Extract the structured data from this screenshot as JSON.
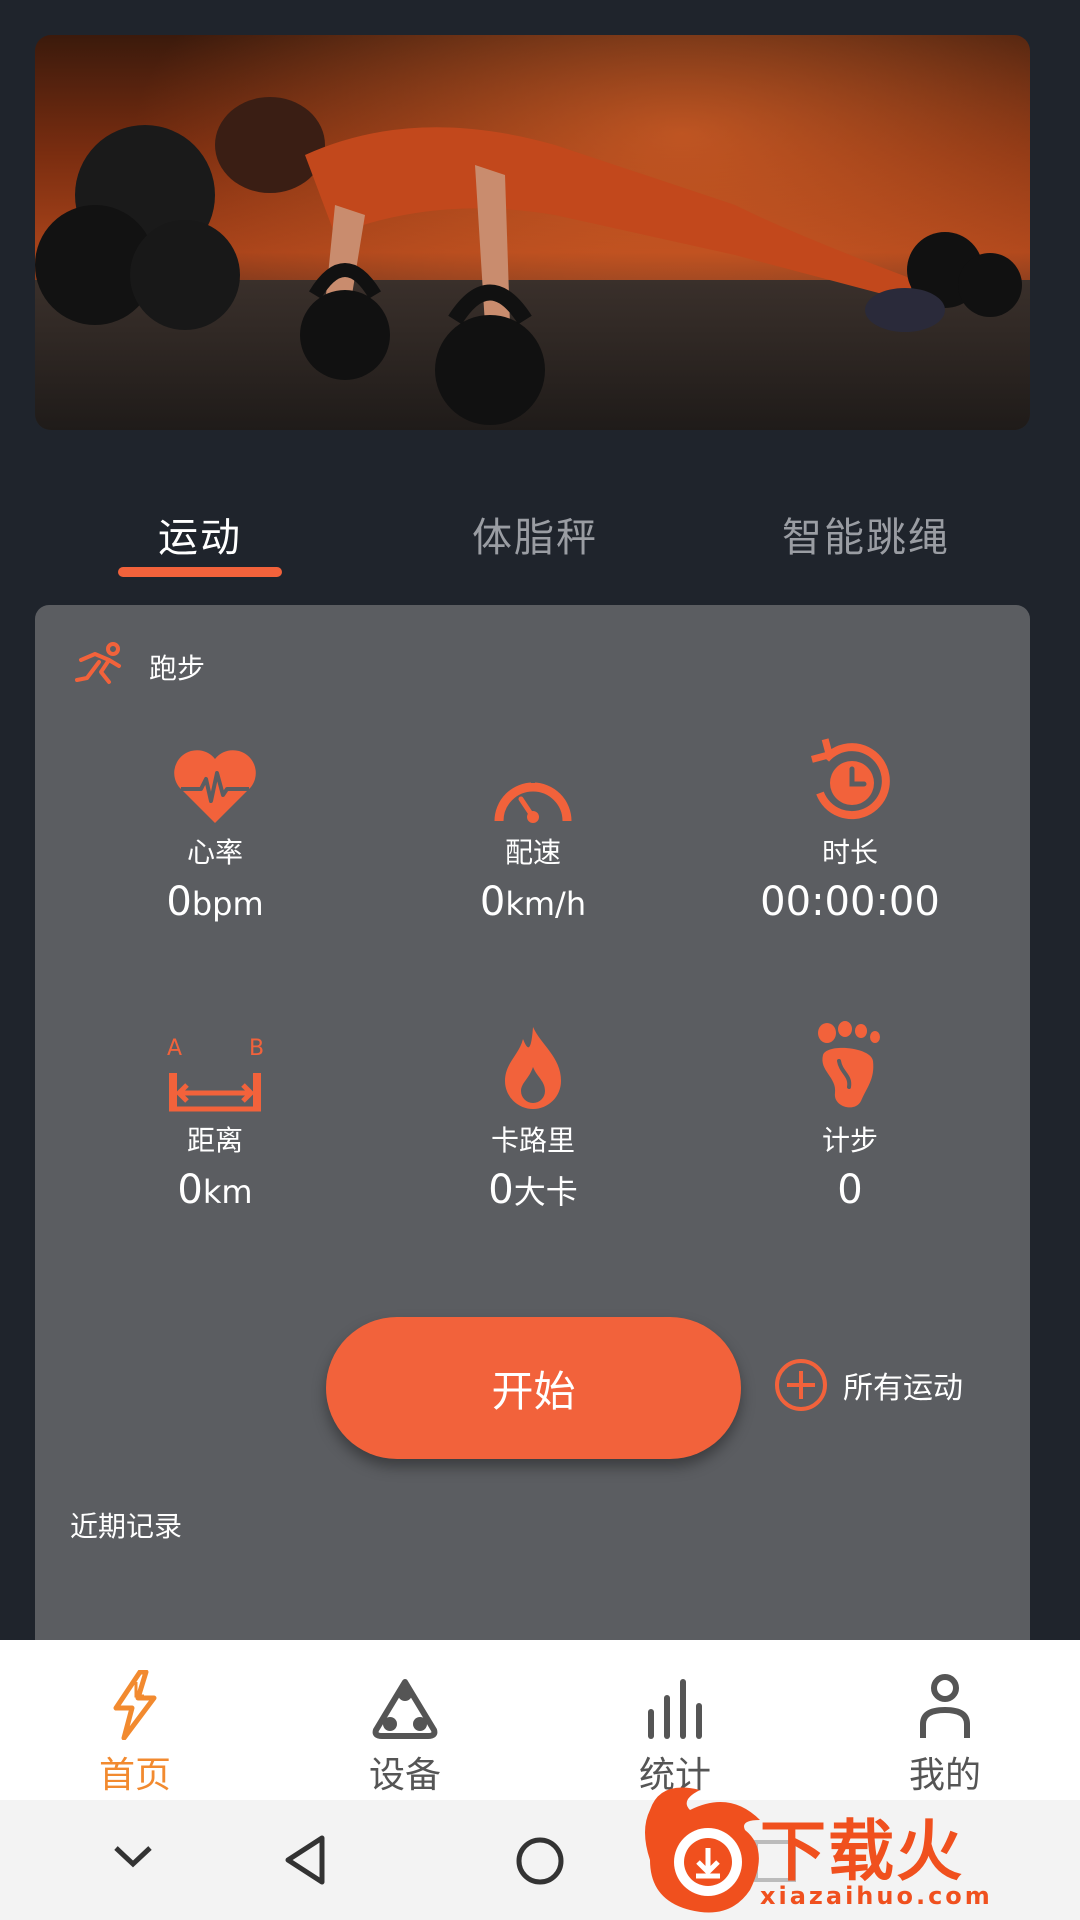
{
  "tabs": [
    "运动",
    "体脂秤",
    "智能跳绳"
  ],
  "sport": {
    "name": "跑步"
  },
  "metrics": [
    {
      "label": "心率",
      "value": "0",
      "unit": "bpm",
      "icon": "heart-rate-icon"
    },
    {
      "label": "配速",
      "value": "0",
      "unit": "km/h",
      "icon": "speedometer-icon"
    },
    {
      "label": "时长",
      "value": "00:00:00",
      "unit": "",
      "icon": "timer-icon"
    },
    {
      "label": "距离",
      "value": "0",
      "unit": "km",
      "icon": "distance-icon"
    },
    {
      "label": "卡路里",
      "value": "0",
      "unit": "大卡",
      "icon": "flame-icon"
    },
    {
      "label": "计步",
      "value": "0",
      "unit": "",
      "icon": "footprint-icon"
    }
  ],
  "distance_icon_letters": {
    "a": "A",
    "b": "B"
  },
  "start_label": "开始",
  "all_sports_label": "所有运动",
  "recent_label": "近期记录",
  "nav": [
    {
      "label": "首页",
      "icon": "bolt-icon",
      "active": true
    },
    {
      "label": "设备",
      "icon": "device-icon",
      "active": false
    },
    {
      "label": "统计",
      "icon": "stats-icon",
      "active": false
    },
    {
      "label": "我的",
      "icon": "profile-icon",
      "active": false
    }
  ],
  "watermark": {
    "text": "下载火",
    "url": "xiazaihuo.com"
  },
  "colors": {
    "accent": "#f2623b",
    "nav_active": "#f28a2f",
    "background": "#1f242c",
    "card": "#5b5d61"
  }
}
